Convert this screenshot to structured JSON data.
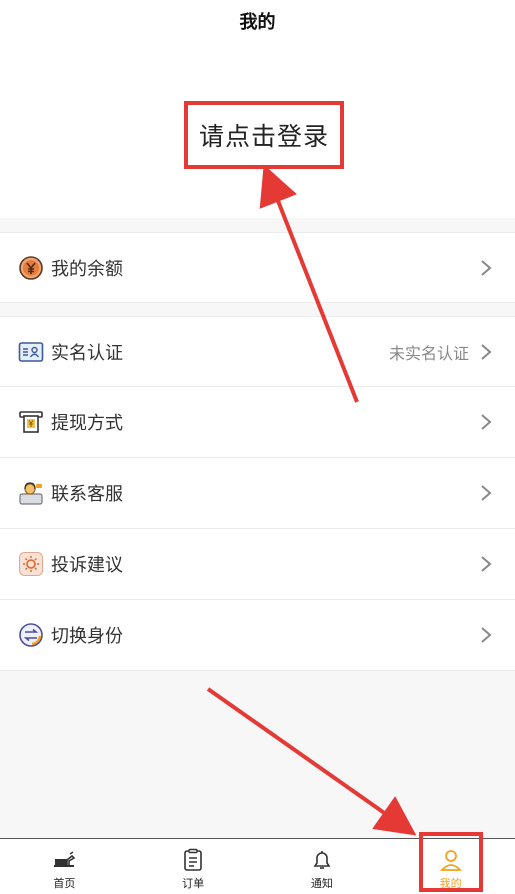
{
  "nav": {
    "title": "我的"
  },
  "login": {
    "prompt": "请点击登录"
  },
  "menu": [
    {
      "label": "我的余额",
      "value": "",
      "icon": "yen-coin-icon"
    },
    {
      "label": "实名认证",
      "value": "未实名认证",
      "icon": "id-card-icon"
    },
    {
      "label": "提现方式",
      "value": "",
      "icon": "withdraw-icon"
    },
    {
      "label": "联系客服",
      "value": "",
      "icon": "customer-service-icon"
    },
    {
      "label": "投诉建议",
      "value": "",
      "icon": "feedback-icon"
    },
    {
      "label": "切换身份",
      "value": "",
      "icon": "switch-identity-icon"
    }
  ],
  "tabs": [
    {
      "label": "首页",
      "icon": "home-truck-icon",
      "active": false
    },
    {
      "label": "订单",
      "icon": "order-list-icon",
      "active": false
    },
    {
      "label": "通知",
      "icon": "bell-icon",
      "active": false
    },
    {
      "label": "我的",
      "icon": "user-icon",
      "active": true
    }
  ],
  "colors": {
    "accent": "#f3a21d",
    "annotation": "#e53935"
  }
}
